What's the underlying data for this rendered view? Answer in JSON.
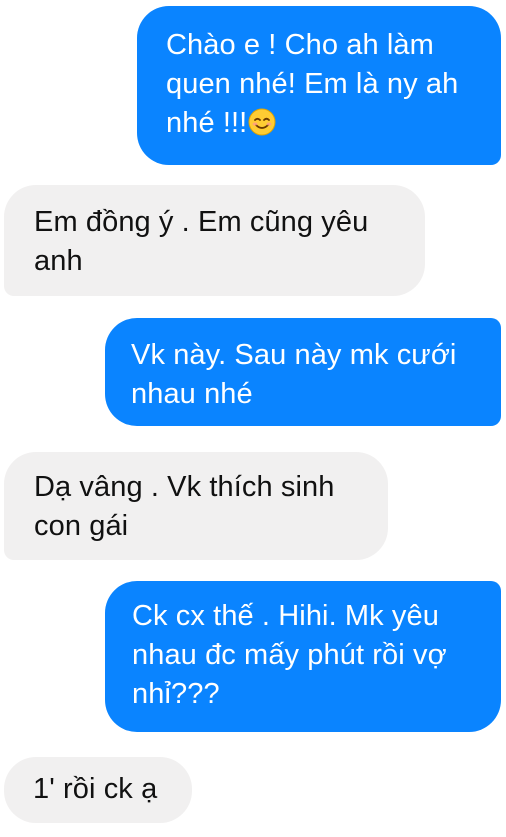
{
  "messages": [
    {
      "direction": "outgoing",
      "lines": [
        "Chào e ! Cho ah làm",
        "quen nhé! Em là ny ah",
        "nhé !!!"
      ],
      "emoji": "smiling-face-icon"
    },
    {
      "direction": "incoming",
      "lines": [
        "Em đồng ý . Em cũng yêu",
        "anh"
      ]
    },
    {
      "direction": "outgoing",
      "lines": [
        "Vk này. Sau này mk cưới",
        "nhau nhé"
      ]
    },
    {
      "direction": "incoming",
      "lines": [
        "Dạ vâng . Vk thích sinh",
        "con gái"
      ]
    },
    {
      "direction": "outgoing",
      "lines": [
        "Ck cx thế . Hihi. Mk yêu",
        "nhau đc mấy phút rồi vợ",
        "nhỉ???"
      ]
    },
    {
      "direction": "incoming",
      "lines": [
        "1' rồi ck ạ"
      ]
    }
  ],
  "colors": {
    "outgoing_bubble": "#0a84ff",
    "incoming_bubble": "#f1f0f0",
    "background": "#ffffff"
  }
}
